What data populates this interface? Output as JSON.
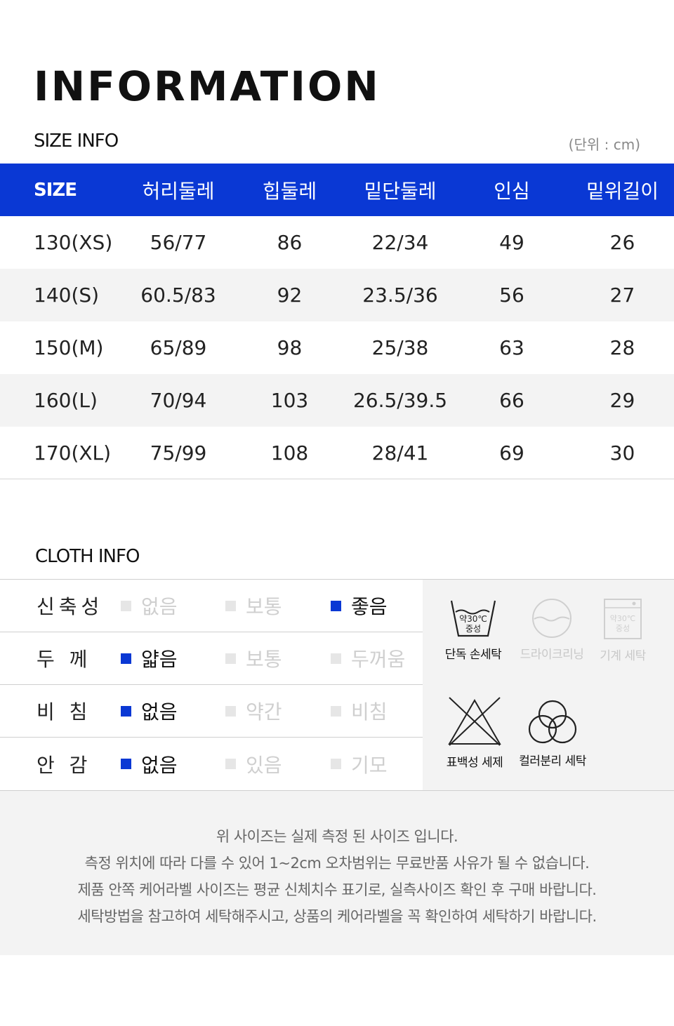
{
  "header": {
    "title": "INFORMATION"
  },
  "size_info": {
    "label": "SIZE INFO",
    "unit": "(단위 : cm)",
    "columns": [
      "SIZE",
      "허리둘레",
      "힙둘레",
      "밑단둘레",
      "인심",
      "밑위길이"
    ],
    "rows": [
      [
        "130(XS)",
        "56/77",
        "86",
        "22/34",
        "49",
        "26"
      ],
      [
        "140(S)",
        "60.5/83",
        "92",
        "23.5/36",
        "56",
        "27"
      ],
      [
        "150(M)",
        "65/89",
        "98",
        "25/38",
        "63",
        "28"
      ],
      [
        "160(L)",
        "70/94",
        "103",
        "26.5/39.5",
        "66",
        "29"
      ],
      [
        "170(XL)",
        "75/99",
        "108",
        "28/41",
        "69",
        "30"
      ]
    ]
  },
  "cloth_info": {
    "label": "CLOTH INFO",
    "rows": [
      {
        "name": "신축성",
        "options": [
          "없음",
          "보통",
          "좋음"
        ],
        "selected": 2
      },
      {
        "name": "두 께",
        "options": [
          "얇음",
          "보통",
          "두꺼움"
        ],
        "selected": 0
      },
      {
        "name": "비 침",
        "options": [
          "없음",
          "약간",
          "비침"
        ],
        "selected": 0
      },
      {
        "name": "안 감",
        "options": [
          "없음",
          "있음",
          "기모"
        ],
        "selected": 0
      }
    ],
    "care": [
      {
        "icon": "hand-wash-icon",
        "label": "단독 손세탁",
        "active": true,
        "symbol_text": [
          "약30℃",
          "중성"
        ]
      },
      {
        "icon": "dry-clean-icon",
        "label": "드라이크리닝",
        "active": false
      },
      {
        "icon": "machine-wash-icon",
        "label": "기계 세탁",
        "active": false,
        "symbol_text": [
          "약30℃",
          "중성"
        ]
      },
      {
        "icon": "no-bleach-icon",
        "label": "표백성 세제",
        "active": true
      },
      {
        "icon": "color-separate-icon",
        "label": "컬러분리 세탁",
        "active": true
      }
    ]
  },
  "notice": {
    "lines": [
      "위 사이즈는 실제 측정 된 사이즈 입니다.",
      "측정 위치에 따라 다를 수 있어 1~2cm 오차범위는 무료반품 사유가 될 수 없습니다.",
      "제품 안쪽 케어라벨 사이즈는 평균 신체치수 표기로, 실측사이즈 확인 후 구매 바랍니다.",
      "세탁방법을 참고하여 세탁해주시고, 상품의 케어라벨을 꼭 확인하여 세탁하기 바랍니다."
    ]
  },
  "colors": {
    "accent": "#0a38d4",
    "row_alt": "#f3f3f3",
    "inactive": "#cfcfcf"
  }
}
